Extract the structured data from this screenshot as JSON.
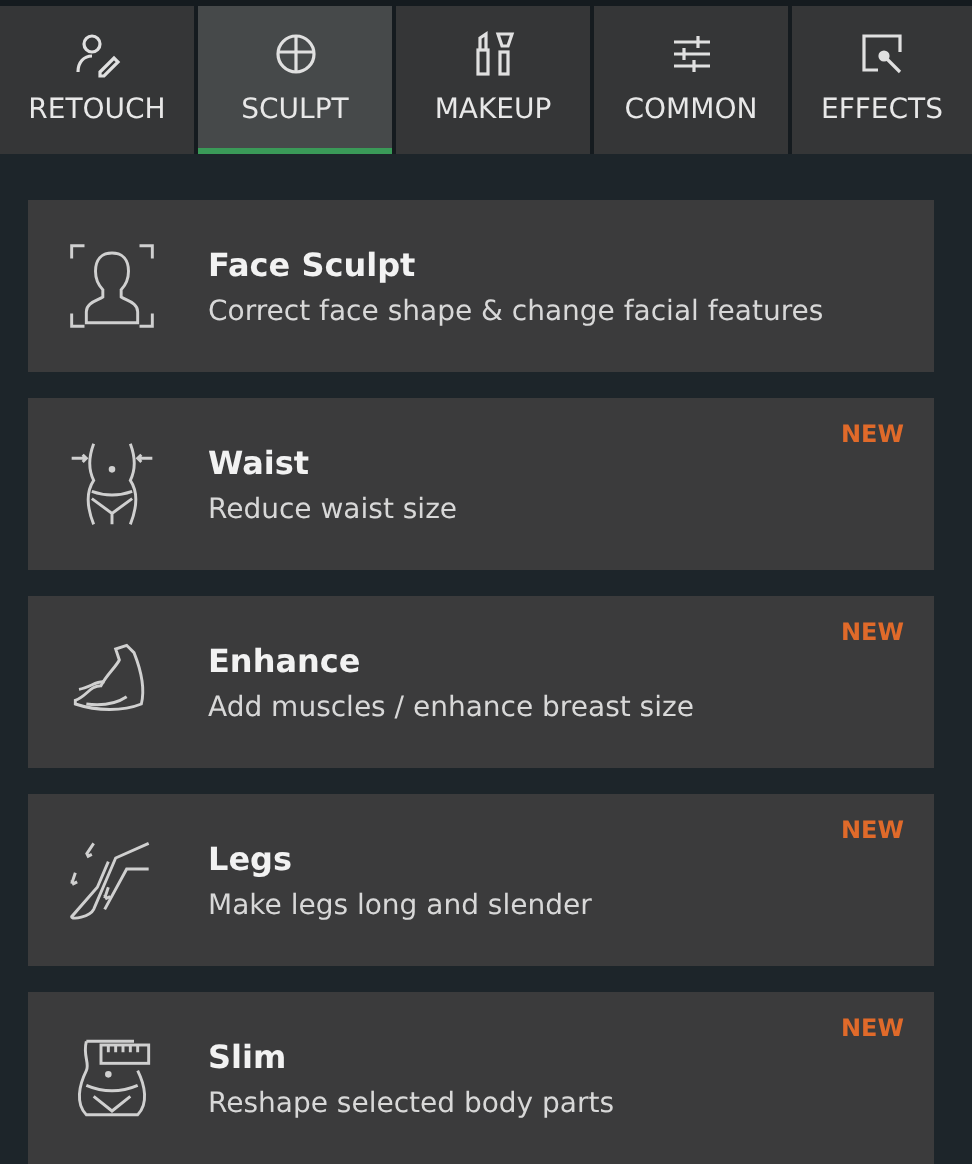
{
  "tabs": [
    {
      "label": "RETOUCH",
      "selected": false
    },
    {
      "label": "SCULPT",
      "selected": true
    },
    {
      "label": "MAKEUP",
      "selected": false
    },
    {
      "label": "COMMON",
      "selected": false
    },
    {
      "label": "EFFECTS",
      "selected": false
    }
  ],
  "tools": [
    {
      "title": "Face Sculpt",
      "description": "Correct face shape & change facial features"
    },
    {
      "title": "Waist",
      "description": "Reduce waist size",
      "badge": "NEW"
    },
    {
      "title": "Enhance",
      "description": "Add muscles / enhance breast size",
      "badge": "NEW"
    },
    {
      "title": "Legs",
      "description": "Make legs long and slender",
      "badge": "NEW"
    },
    {
      "title": "Slim",
      "description": "Reshape selected body parts",
      "badge": "NEW"
    }
  ]
}
